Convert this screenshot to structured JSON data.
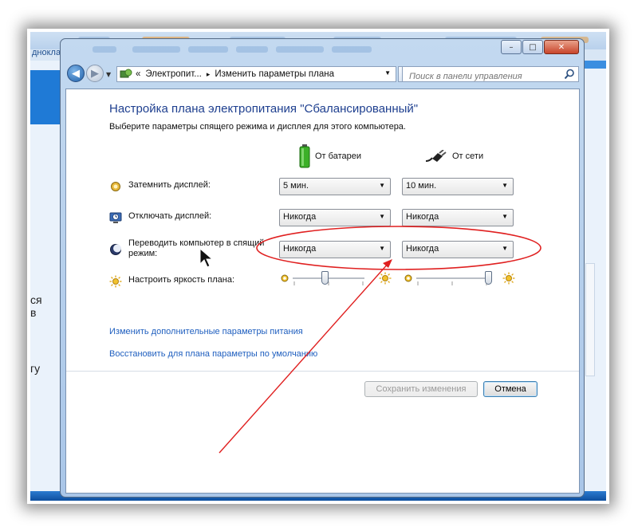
{
  "background": {
    "left_text": "дноклас",
    "side_texts": [
      "ся",
      "в",
      "гу"
    ]
  },
  "window": {
    "buttons": {
      "minimize": "–",
      "maximize": "□",
      "close": "✕"
    }
  },
  "navigation": {
    "address_overflow": "«",
    "breadcrumb": [
      "Электропит...",
      "Изменить параметры плана"
    ],
    "breadcrumb_sep": "▸",
    "refresh_glyph": "↻",
    "search_placeholder": "Поиск в панели управления"
  },
  "main": {
    "title": "Настройка плана электропитания \"Сбалансированный\"",
    "subtitle": "Выберите параметры спящего режима и дисплея для этого компьютера.",
    "columns": {
      "battery": {
        "label": "От батареи",
        "icon": "battery-icon"
      },
      "plugged": {
        "label": "От сети",
        "icon": "power-plug-icon"
      }
    },
    "rows": [
      {
        "label": "Затемнить дисплей:",
        "icon": "dim-display-icon",
        "battery": "5 мин.",
        "plugged": "10 мин."
      },
      {
        "label": "Отключать дисплей:",
        "icon": "display-off-icon",
        "battery": "Никогда",
        "plugged": "Никогда"
      },
      {
        "label_line1": "Переводить компьютер в спящий",
        "label_line2": "режим:",
        "icon": "sleep-moon-icon",
        "battery": "Никогда",
        "plugged": "Никогда"
      }
    ],
    "brightness": {
      "label": "Настроить яркость плана:",
      "icon": "brightness-sun-icon",
      "battery_level": 0.45,
      "plugged_level": 1.0
    },
    "links": [
      "Изменить дополнительные параметры питания",
      "Восстановить для плана параметры по умолчанию"
    ],
    "buttons": {
      "save": "Сохранить изменения",
      "cancel": "Отмена"
    }
  },
  "annotation": {
    "color": "#e02020"
  }
}
